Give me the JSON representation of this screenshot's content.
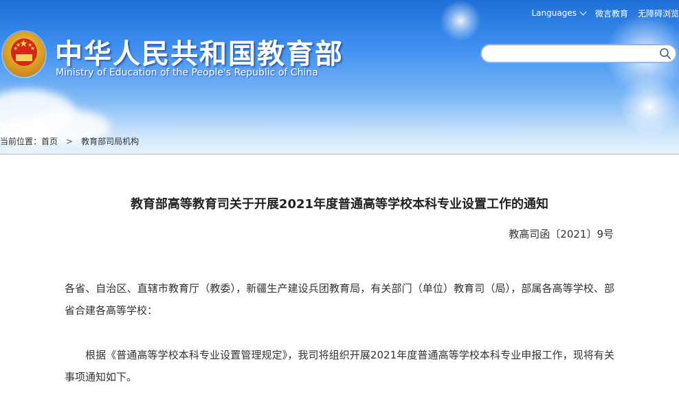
{
  "header": {
    "title_cn": "中华人民共和国教育部",
    "title_en": "Ministry of Education of the People's Republic of China",
    "top_links": {
      "languages": "Languages",
      "weibo": "微言教育",
      "accessibility": "无障碍浏览"
    },
    "search": {
      "placeholder": "",
      "value": ""
    }
  },
  "breadcrumb": {
    "prefix": "当前位置：",
    "home": "首页",
    "separator": ">",
    "current": "教育部司局机构"
  },
  "document": {
    "title": "教育部高等教育司关于开展2021年度普通高等学校本科专业设置工作的通知",
    "number": "教高司函〔2021〕9号",
    "addressee": "各省、自治区、直辖市教育厅（教委），新疆生产建设兵团教育局，有关部门（单位）教育司（局），部属各高等学校、部省合建各高等学校：",
    "body_p1": "根据《普通高等学校本科专业设置管理规定》，我司将组织开展2021年度普通高等学校本科专业申报工作，现将有关事项通知如下。"
  },
  "colors": {
    "header_top": "#1e6fd6",
    "header_bottom": "#e9f3fd",
    "emblem_red": "#d62617",
    "emblem_gold": "#f2cb50",
    "search_border": "#8db6ee"
  }
}
